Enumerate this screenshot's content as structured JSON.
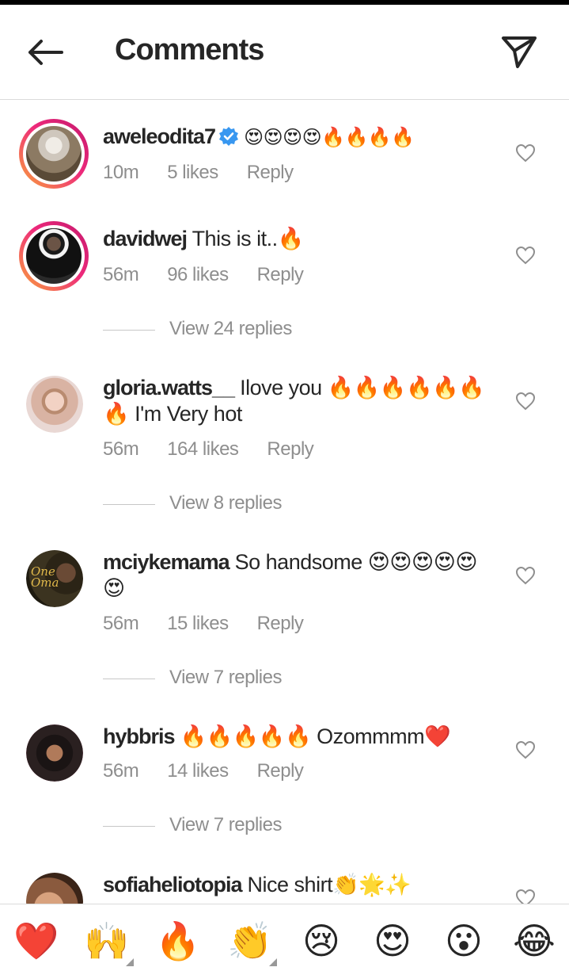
{
  "header": {
    "title": "Comments",
    "back_icon": "arrow-left-icon",
    "share_icon": "send-icon"
  },
  "comments": [
    {
      "username": "aweleodita7",
      "verified": true,
      "text": "😍😍😍😍🔥🔥🔥🔥",
      "time": "10m",
      "likes": "5 likes",
      "reply": "Reply",
      "story_ring": true
    },
    {
      "username": "davidwej",
      "verified": false,
      "text": "This is it..🔥",
      "time": "56m",
      "likes": "96 likes",
      "reply": "Reply",
      "story_ring": true,
      "view_replies": "View 24 replies"
    },
    {
      "username": "gloria.watts__",
      "verified": false,
      "text": "Ilove you 🔥🔥🔥🔥🔥🔥🔥 I'm Very hot",
      "time": "56m",
      "likes": "164 likes",
      "reply": "Reply",
      "story_ring": false,
      "view_replies": "View 8 replies"
    },
    {
      "username": "mciykemama",
      "verified": false,
      "text": "So handsome 😍😍😍😍😍😍",
      "time": "56m",
      "likes": "15 likes",
      "reply": "Reply",
      "story_ring": false,
      "view_replies": "View 7 replies"
    },
    {
      "username": "hybbris",
      "verified": false,
      "text": "🔥🔥🔥🔥🔥 Ozommmm❤️",
      "time": "56m",
      "likes": "14 likes",
      "reply": "Reply",
      "story_ring": false,
      "view_replies": "View 7 replies"
    },
    {
      "username": "sofiaheliotopia",
      "verified": false,
      "text": "Nice shirt👏🌟✨",
      "story_ring": false
    }
  ],
  "emoji_bar": [
    "❤️",
    "🙌",
    "🔥",
    "👏",
    "😢",
    "😍",
    "😮",
    "😂"
  ],
  "colors": {
    "accent_verified": "#3897f0",
    "story_ring_start": "#f9a53a",
    "story_ring_end": "#c3186d",
    "secondary_text": "#8e8e8e"
  }
}
